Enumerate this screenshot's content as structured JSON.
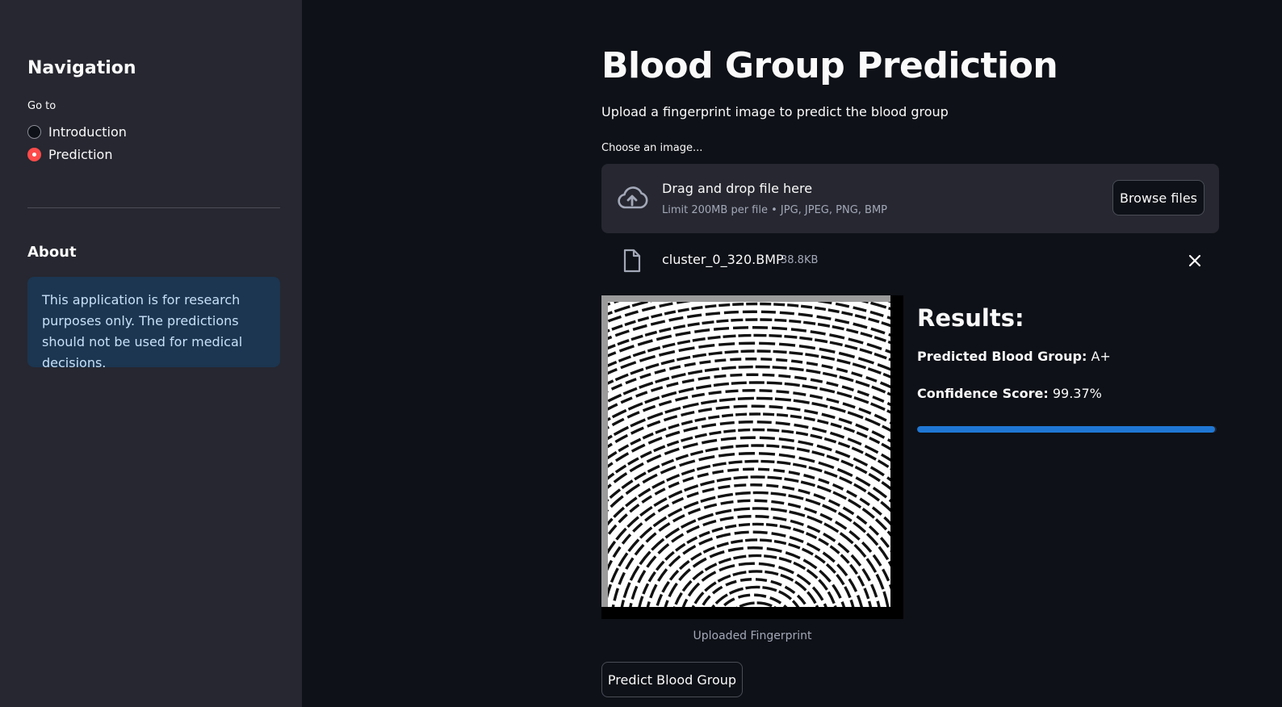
{
  "sidebar": {
    "title": "Navigation",
    "goto_label": "Go to",
    "options": [
      {
        "label": "Introduction",
        "selected": false
      },
      {
        "label": "Prediction",
        "selected": true
      }
    ],
    "about_title": "About",
    "about_text": "This application is for research purposes only. The predictions should not be used for medical decisions."
  },
  "main": {
    "title": "Blood Group Prediction",
    "subtitle": "Upload a fingerprint image to predict the blood group",
    "uploader": {
      "label": "Choose an image...",
      "drop_text": "Drag and drop file here",
      "limit_text": "Limit 200MB per file • JPG, JPEG, PNG, BMP",
      "browse_label": "Browse files",
      "icon": "cloud-upload-icon"
    },
    "file": {
      "name": "cluster_0_320.BMP",
      "size": "38.8KB",
      "icon": "file-icon"
    },
    "image_caption": "Uploaded Fingerprint",
    "results": {
      "title": "Results:",
      "group_label": "Predicted Blood Group:",
      "group_value": "A+",
      "confidence_label": "Confidence Score:",
      "confidence_value": "99.37%",
      "confidence_fraction": 0.9937
    },
    "predict_label": "Predict Blood Group"
  },
  "colors": {
    "accent": "#ff4b4b",
    "progress": "#1f77d4",
    "info_bg": "#1c3550",
    "background": "#0e1117",
    "sidebar_bg": "#262730"
  }
}
